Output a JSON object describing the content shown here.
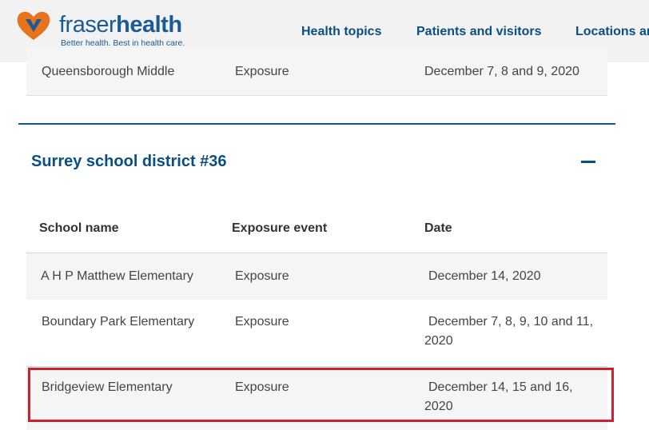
{
  "header": {
    "logo_word_1": "fraser",
    "logo_word_2": "health",
    "tagline": "Better health. Best in health care.",
    "nav": [
      "Health topics",
      "Patients and visitors",
      "Locations ar"
    ]
  },
  "previous_row": {
    "school": "Queensborough Middle",
    "event": "Exposure",
    "date": "December 7, 8 and 9, 2020"
  },
  "section": {
    "title": "Surrey school district #36",
    "toggle_symbol": "—",
    "columns": [
      "School name",
      "Exposure event",
      "Date"
    ],
    "rows": [
      {
        "school": "A H P Matthew Elementary",
        "event": "Exposure",
        "date": "December 14, 2020"
      },
      {
        "school": "Boundary Park Elementary",
        "event": "Exposure",
        "date": "December 7, 8, 9, 10 and 11,",
        "date_line2": "2020"
      },
      {
        "school": "Bridgeview Elementary",
        "event": "Exposure",
        "date": "December 14, 15 and 16,",
        "date_line2": "2020"
      }
    ]
  },
  "colors": {
    "brand_blue": "#0b4e82",
    "logo_orange": "#e8731d",
    "highlight_red": "#d0202f"
  }
}
